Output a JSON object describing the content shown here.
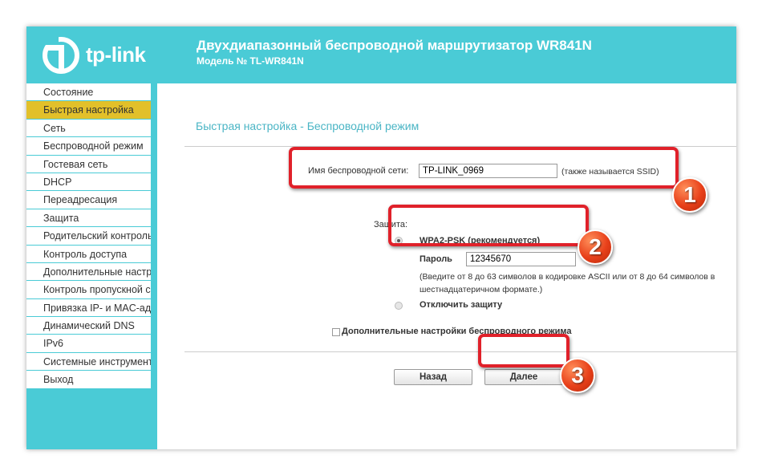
{
  "header": {
    "logo_text": "tp-link",
    "title": "Двухдиапазонный беспроводной маршрутизатор WR841N",
    "model": "Модель № TL-WR841N"
  },
  "sidebar": {
    "items": [
      {
        "label": "Состояние"
      },
      {
        "label": "Быстрая настройка",
        "active": true
      },
      {
        "label": "Сеть"
      },
      {
        "label": "Беспроводной режим"
      },
      {
        "label": "Гостевая сеть"
      },
      {
        "label": "DHCP"
      },
      {
        "label": "Переадресация"
      },
      {
        "label": "Защита"
      },
      {
        "label": "Родительский контроль"
      },
      {
        "label": "Контроль доступа"
      },
      {
        "label": "Дополнительные настройки маршрутизации"
      },
      {
        "label": "Контроль пропускной способности"
      },
      {
        "label": "Привязка IP- и MAC-адресов"
      },
      {
        "label": "Динамический DNS"
      },
      {
        "label": "IPv6"
      },
      {
        "label": "Системные инструменты"
      },
      {
        "label": "Выход"
      }
    ]
  },
  "main": {
    "page_title": "Быстрая настройка - Беспроводной режим",
    "ssid_label": "Имя беспроводной сети:",
    "ssid_value": "TP-LINK_0969",
    "ssid_hint": "(также называется SSID)",
    "security_label": "Защита:",
    "wpa2_label": "WPA2-PSK (рекомендуется)",
    "password_label": "Пароль",
    "password_value": "12345670",
    "password_hint_1": "(Введите от 8 до 63 символов в кодировке ASCII или от 8 до 64 символов в",
    "password_hint_2": "шестнадцатеричном формате.)",
    "disable_label": "Отключить защиту",
    "advanced_label": "Дополнительные настройки беспроводного режима",
    "back_label": "Назад",
    "next_label": "Далее"
  },
  "annotations": {
    "badge_1": "1",
    "badge_2": "2",
    "badge_3": "3"
  },
  "colors": {
    "brand": "#4acbd6",
    "active_menu": "#e2c02a",
    "callout": "#e0212a"
  }
}
